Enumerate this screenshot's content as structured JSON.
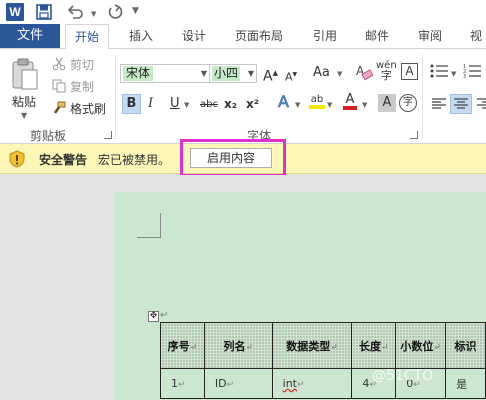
{
  "app": {
    "logo_letter": "W"
  },
  "tabs": {
    "file": "文件",
    "items": [
      "开始",
      "插入",
      "设计",
      "页面布局",
      "引用",
      "邮件",
      "审阅",
      "视图"
    ]
  },
  "clipboard": {
    "paste": "粘贴",
    "cut": "剪切",
    "copy": "复制",
    "format_painter": "格式刷",
    "group_label": "剪贴板"
  },
  "font": {
    "name": "宋体",
    "size": "小四",
    "grow": "A",
    "shrink": "A",
    "case": "Aa",
    "clear_format": "A",
    "phonetic": "wén",
    "border_char": "A",
    "bold": "B",
    "italic": "I",
    "underline": "U",
    "strike": "abc",
    "sub": "x₂",
    "sup": "x²",
    "text_effect": "A",
    "highlight": "ab",
    "font_color": "A",
    "shade_char": "A",
    "enclose": "字",
    "group_label": "字体"
  },
  "security": {
    "title": "安全警告",
    "message": "宏已被禁用。",
    "button": "启用内容"
  },
  "table": {
    "headers": [
      "序号",
      "列名",
      "数据类型",
      "长度",
      "小数位",
      "标识"
    ],
    "row": [
      "1",
      "ID",
      "int",
      "4",
      "0",
      "是"
    ],
    "cell_mark": "↵"
  },
  "watermark": "@51CTO",
  "colors": {
    "word_blue": "#2b579a",
    "security_bar": "#fcf7b6",
    "highlight_border": "#e030d0",
    "page_green": "#cde6cf"
  }
}
